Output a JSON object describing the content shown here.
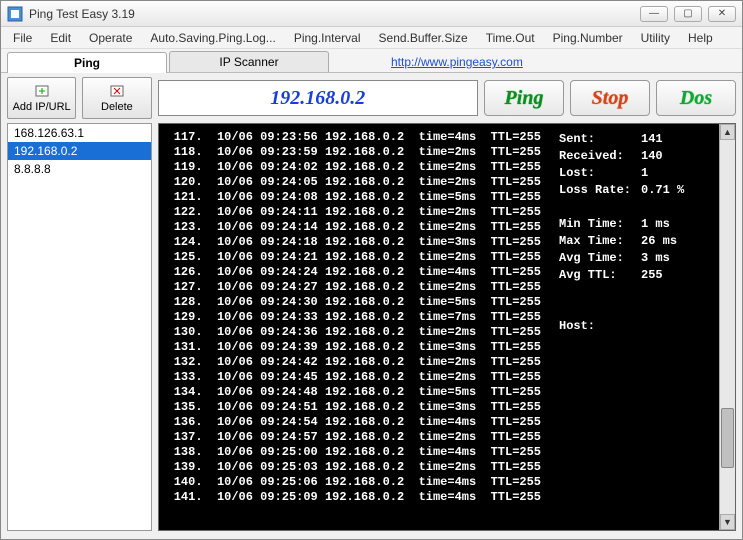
{
  "window": {
    "title": "Ping Test Easy 3.19"
  },
  "menu": {
    "items": [
      "File",
      "Edit",
      "Operate",
      "Auto.Saving.Ping.Log...",
      "Ping.Interval",
      "Send.Buffer.Size",
      "Time.Out",
      "Ping.Number",
      "Utility",
      "Help"
    ]
  },
  "tabs": {
    "ping": "Ping",
    "ipscanner": "IP Scanner",
    "link": "http://www.pingeasy.com"
  },
  "toolbar": {
    "add_label": "Add IP/URL",
    "delete_label": "Delete"
  },
  "ip_list": {
    "items": [
      "168.126.63.1",
      "192.168.0.2",
      "8.8.8.8"
    ],
    "selected_index": 1
  },
  "controls": {
    "current_ip": "192.168.0.2",
    "ping_label": "Ping",
    "stop_label": "Stop",
    "dos_label": "Dos"
  },
  "log": {
    "lines": [
      {
        "n": "117",
        "ts": "10/06 09:23:56",
        "ip": "192.168.0.2",
        "time": "4ms",
        "ttl": "255"
      },
      {
        "n": "118",
        "ts": "10/06 09:23:59",
        "ip": "192.168.0.2",
        "time": "2ms",
        "ttl": "255"
      },
      {
        "n": "119",
        "ts": "10/06 09:24:02",
        "ip": "192.168.0.2",
        "time": "2ms",
        "ttl": "255"
      },
      {
        "n": "120",
        "ts": "10/06 09:24:05",
        "ip": "192.168.0.2",
        "time": "2ms",
        "ttl": "255"
      },
      {
        "n": "121",
        "ts": "10/06 09:24:08",
        "ip": "192.168.0.2",
        "time": "5ms",
        "ttl": "255"
      },
      {
        "n": "122",
        "ts": "10/06 09:24:11",
        "ip": "192.168.0.2",
        "time": "2ms",
        "ttl": "255"
      },
      {
        "n": "123",
        "ts": "10/06 09:24:14",
        "ip": "192.168.0.2",
        "time": "2ms",
        "ttl": "255"
      },
      {
        "n": "124",
        "ts": "10/06 09:24:18",
        "ip": "192.168.0.2",
        "time": "3ms",
        "ttl": "255"
      },
      {
        "n": "125",
        "ts": "10/06 09:24:21",
        "ip": "192.168.0.2",
        "time": "2ms",
        "ttl": "255"
      },
      {
        "n": "126",
        "ts": "10/06 09:24:24",
        "ip": "192.168.0.2",
        "time": "4ms",
        "ttl": "255"
      },
      {
        "n": "127",
        "ts": "10/06 09:24:27",
        "ip": "192.168.0.2",
        "time": "2ms",
        "ttl": "255"
      },
      {
        "n": "128",
        "ts": "10/06 09:24:30",
        "ip": "192.168.0.2",
        "time": "5ms",
        "ttl": "255"
      },
      {
        "n": "129",
        "ts": "10/06 09:24:33",
        "ip": "192.168.0.2",
        "time": "7ms",
        "ttl": "255"
      },
      {
        "n": "130",
        "ts": "10/06 09:24:36",
        "ip": "192.168.0.2",
        "time": "2ms",
        "ttl": "255"
      },
      {
        "n": "131",
        "ts": "10/06 09:24:39",
        "ip": "192.168.0.2",
        "time": "3ms",
        "ttl": "255"
      },
      {
        "n": "132",
        "ts": "10/06 09:24:42",
        "ip": "192.168.0.2",
        "time": "2ms",
        "ttl": "255"
      },
      {
        "n": "133",
        "ts": "10/06 09:24:45",
        "ip": "192.168.0.2",
        "time": "2ms",
        "ttl": "255"
      },
      {
        "n": "134",
        "ts": "10/06 09:24:48",
        "ip": "192.168.0.2",
        "time": "5ms",
        "ttl": "255"
      },
      {
        "n": "135",
        "ts": "10/06 09:24:51",
        "ip": "192.168.0.2",
        "time": "3ms",
        "ttl": "255"
      },
      {
        "n": "136",
        "ts": "10/06 09:24:54",
        "ip": "192.168.0.2",
        "time": "4ms",
        "ttl": "255"
      },
      {
        "n": "137",
        "ts": "10/06 09:24:57",
        "ip": "192.168.0.2",
        "time": "2ms",
        "ttl": "255"
      },
      {
        "n": "138",
        "ts": "10/06 09:25:00",
        "ip": "192.168.0.2",
        "time": "4ms",
        "ttl": "255"
      },
      {
        "n": "139",
        "ts": "10/06 09:25:03",
        "ip": "192.168.0.2",
        "time": "2ms",
        "ttl": "255"
      },
      {
        "n": "140",
        "ts": "10/06 09:25:06",
        "ip": "192.168.0.2",
        "time": "4ms",
        "ttl": "255"
      },
      {
        "n": "141",
        "ts": "10/06 09:25:09",
        "ip": "192.168.0.2",
        "time": "4ms",
        "ttl": "255"
      }
    ]
  },
  "stats": {
    "sent_label": "Sent:",
    "sent": "141",
    "recv_label": "Received:",
    "recv": "140",
    "lost_label": "Lost:",
    "lost": "1",
    "lossrate_label": "Loss Rate:",
    "lossrate": "0.71 %",
    "min_label": "Min Time:",
    "min": "1 ms",
    "max_label": "Max Time:",
    "max": "26 ms",
    "avg_label": "Avg Time:",
    "avg": "3 ms",
    "avgttl_label": "Avg TTL:",
    "avgttl": "255",
    "host_label": "Host:",
    "host": ""
  }
}
